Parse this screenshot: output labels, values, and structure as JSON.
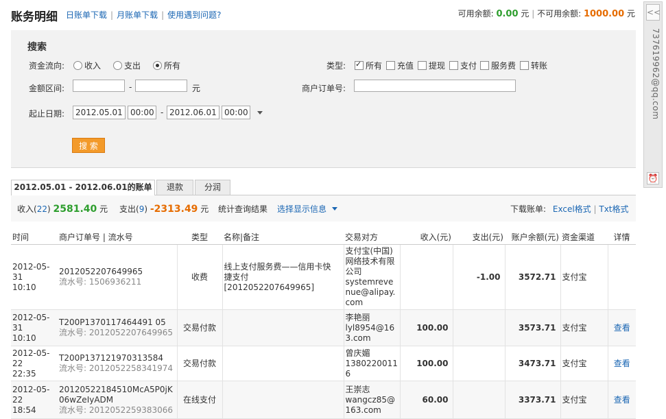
{
  "header": {
    "title": "账务明细",
    "links": [
      "日账单下载",
      "月账单下载",
      "使用遇到问题?"
    ],
    "available_label": "可用余额:",
    "available_value": "0.00",
    "unavailable_label": "不可用余额:",
    "unavailable_value": "1000.00",
    "currency": "元"
  },
  "search": {
    "title": "搜索",
    "flow_label": "资金流向:",
    "flow_options": [
      "收入",
      "支出",
      "所有"
    ],
    "flow_selected": "所有",
    "type_label": "类型:",
    "type_options": [
      "所有",
      "充值",
      "提现",
      "支付",
      "服务费",
      "转账"
    ],
    "type_checked": [
      "所有"
    ],
    "amount_label": "金额区间:",
    "amount_unit": "元",
    "order_label": "商户订单号:",
    "date_label": "起止日期:",
    "start_date": "2012.05.01",
    "start_time": "00:00",
    "end_date": "2012.06.01",
    "end_time": "00:00",
    "dash": "-",
    "button": "搜 索"
  },
  "tabs": [
    "2012.05.01 - 2012.06.01的账单",
    "退款",
    "分润"
  ],
  "summary": {
    "income_label": "收入(",
    "income_count": "22",
    "income_close": ")",
    "income_value": "2581.40",
    "expense_label": "支出(",
    "expense_count": "9",
    "expense_close": ")",
    "expense_value": "-2313.49",
    "unit": "元",
    "stats_link": "统计查询结果",
    "display_link": "选择显示信息",
    "download_label": "下载账单:",
    "excel": "Excel格式",
    "txt": "Txt格式"
  },
  "table": {
    "columns": [
      "时间",
      "商户订单号 | 流水号",
      "类型",
      "名称|备注",
      "交易对方",
      "收入(元)",
      "支出(元)",
      "账户余额(元)",
      "资金渠道",
      "详情"
    ],
    "serial_prefix": "流水号:",
    "rows": [
      {
        "date": "2012-05-31",
        "time": "10:10",
        "order": "2012052207649965",
        "serial": "1506936211",
        "type": "收费",
        "name": "线上支付服务费——信用卡快捷支付[2012052207649965]",
        "party1": "支付宝(中国)网络技术有限公司",
        "party2": "systemrevenue@alipay.com",
        "income": "",
        "expense": "-1.00",
        "balance": "3572.71",
        "channel": "支付宝",
        "detail": ""
      },
      {
        "date": "2012-05-31",
        "time": "10:10",
        "order": "T200P1370117464491 05",
        "serial": "2012052207649965",
        "type": "交易付款",
        "name": "",
        "party1": "李艳丽",
        "party2": "lyl8954@163.com",
        "income": "100.00",
        "expense": "",
        "balance": "3573.71",
        "channel": "支付宝",
        "detail": "查看"
      },
      {
        "date": "2012-05-22",
        "time": "22:35",
        "order": "T200P137121970313584",
        "serial": "2012052258341974",
        "type": "交易付款",
        "name": "",
        "party1": "曾庆媚",
        "party2": "13802200116",
        "income": "100.00",
        "expense": "",
        "balance": "3473.71",
        "channel": "支付宝",
        "detail": "查看"
      },
      {
        "date": "2012-05-22",
        "time": "18:54",
        "order": "20120522184510McA5P0jK06wZeIyADM",
        "serial": "2012052259383066",
        "type": "在线支付",
        "name": "",
        "party1": "王崇志",
        "party2": "wangcz85@163.com",
        "income": "60.00",
        "expense": "",
        "balance": "3373.71",
        "channel": "支付宝",
        "detail": "查看"
      }
    ]
  },
  "sidebar": {
    "collapse": "<<",
    "email": "737619962@qq.com",
    "clock": "⏰"
  },
  "colors": {
    "link": "#1a66b3",
    "green": "#2e9e2e",
    "orange": "#e66c00",
    "button": "#f39a2a"
  }
}
